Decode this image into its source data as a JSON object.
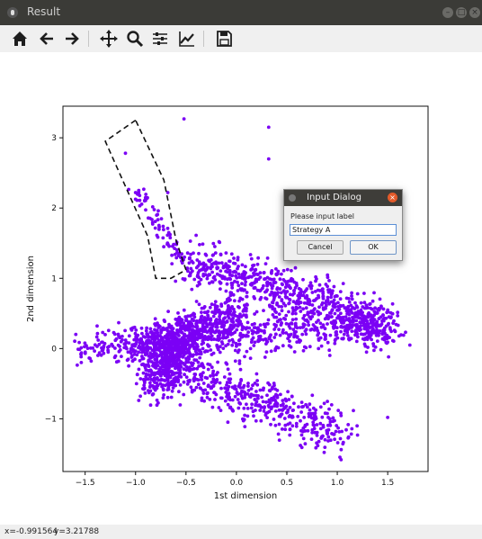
{
  "window": {
    "title": "Result"
  },
  "toolbar": {
    "buttons": [
      {
        "name": "home-icon",
        "tooltip": "Home"
      },
      {
        "name": "back-arrow-icon",
        "tooltip": "Back"
      },
      {
        "name": "forward-arrow-icon",
        "tooltip": "Forward"
      },
      {
        "name": "pan-icon",
        "tooltip": "Pan"
      },
      {
        "name": "zoom-icon",
        "tooltip": "Zoom"
      },
      {
        "name": "configure-subplots-icon",
        "tooltip": "Configure subplots"
      },
      {
        "name": "edit-axis-icon",
        "tooltip": "Edit axis"
      },
      {
        "name": "save-icon",
        "tooltip": "Save"
      }
    ]
  },
  "dialog": {
    "title": "Input Dialog",
    "prompt": "Please input label",
    "value": "Strategy A",
    "cancel_label": "Cancel",
    "ok_label": "OK"
  },
  "status": {
    "x": "x=-0.991564",
    "y": "y=3.21788"
  },
  "chart_data": {
    "type": "scatter",
    "xlabel": "1st dimension",
    "ylabel": "2nd dimension",
    "xlim": [
      -1.72,
      1.9
    ],
    "ylim": [
      -1.75,
      3.45
    ],
    "xticks": [
      -1.5,
      -1.0,
      -0.5,
      0.0,
      0.5,
      1.0,
      1.5
    ],
    "xtick_labels": [
      "−1.5",
      "−1.0",
      "−0.5",
      "0.0",
      "0.5",
      "1.0",
      "1.5"
    ],
    "yticks": [
      -1,
      0,
      1,
      2,
      3
    ],
    "ytick_labels": [
      "−1",
      "0",
      "1",
      "2",
      "3"
    ],
    "grid": false,
    "point_color": "#7b00f5",
    "lasso": [
      [
        -1.0,
        3.25
      ],
      [
        -1.3,
        2.95
      ],
      [
        -0.88,
        1.6
      ],
      [
        -0.8,
        1.0
      ],
      [
        -0.65,
        1.0
      ],
      [
        -0.5,
        1.12
      ],
      [
        -0.6,
        1.55
      ],
      [
        -0.72,
        2.4
      ]
    ],
    "outliers": [
      [
        -0.52,
        3.27
      ],
      [
        0.32,
        3.15
      ],
      [
        0.32,
        2.7
      ],
      [
        -1.1,
        2.78
      ],
      [
        1.72,
        0.05
      ],
      [
        1.5,
        -0.98
      ],
      [
        1.28,
        0.45
      ],
      [
        -0.68,
        2.22
      ]
    ],
    "clusters": [
      {
        "x_range": [
          -0.55,
          1.55
        ],
        "y_range": [
          0.3,
          1.4
        ]
      },
      {
        "x_range": [
          -1.55,
          1.55
        ],
        "y_range": [
          -0.4,
          0.7
        ]
      },
      {
        "x_range": [
          -0.95,
          1.1
        ],
        "y_range": [
          -1.5,
          -0.2
        ]
      },
      {
        "x_range": [
          -1.1,
          -0.45
        ],
        "y_range": [
          1.2,
          2.4
        ]
      }
    ]
  }
}
